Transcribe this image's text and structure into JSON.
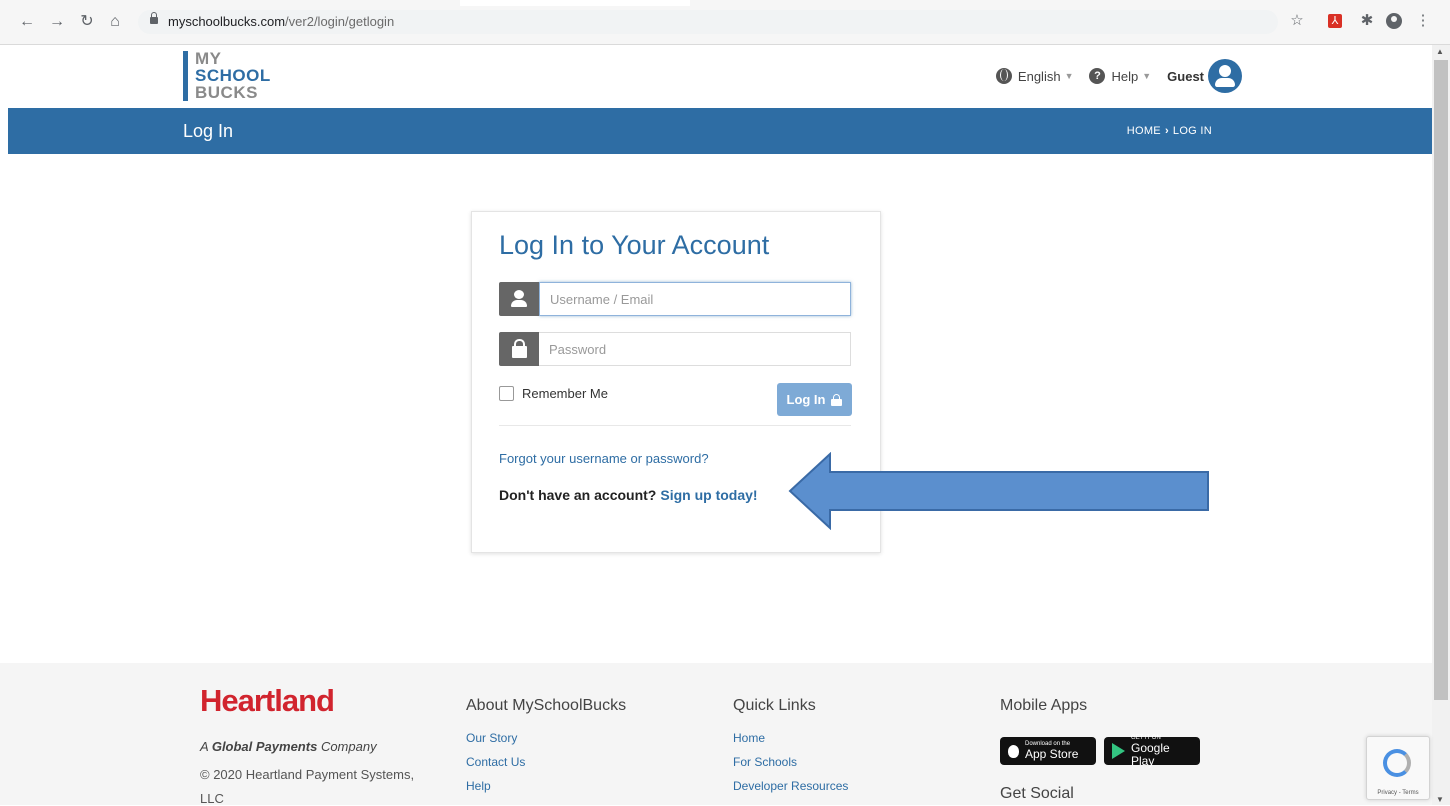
{
  "browser": {
    "url_host": "myschoolbucks.com",
    "url_path": "/ver2/login/getlogin"
  },
  "header": {
    "logo_lines": [
      "MY",
      "SCHOOL",
      "BUCKS"
    ],
    "language_label": "English",
    "help_label": "Help",
    "guest_label": "Guest"
  },
  "title_bar": {
    "title": "Log In",
    "breadcrumb": [
      "HOME",
      "LOG IN"
    ]
  },
  "login": {
    "heading": "Log In to Your Account",
    "username_placeholder": "Username / Email",
    "password_placeholder": "Password",
    "remember_label": "Remember Me",
    "button_label": "Log In",
    "forgot_link": "Forgot your username or password?",
    "no_account_text": "Don't have an account?",
    "signup_link": "Sign up today!"
  },
  "footer": {
    "brand": "Heartland",
    "tagline_prefix": "A",
    "tagline_bold": "Global Payments",
    "tagline_suffix": "Company",
    "copyright_line1": "© 2020 Heartland Payment Systems,",
    "copyright_line2": "LLC",
    "about": {
      "heading": "About MySchoolBucks",
      "links": [
        "Our Story",
        "Contact Us",
        "Help"
      ]
    },
    "quick_links": {
      "heading": "Quick Links",
      "links": [
        "Home",
        "For Schools",
        "Developer Resources"
      ]
    },
    "mobile": {
      "heading": "Mobile Apps",
      "app_store_small": "Download on the",
      "app_store_big": "App Store",
      "google_play_small": "GET IT ON",
      "google_play_big": "Google Play"
    },
    "get_social": "Get Social"
  },
  "recaptcha": {
    "terms": "Privacy - Terms"
  },
  "colors": {
    "brand_blue": "#2e6da4",
    "heartland_red": "#d1242e",
    "login_button": "#7eaad6",
    "annotation_arrow": "#5b8fce"
  }
}
